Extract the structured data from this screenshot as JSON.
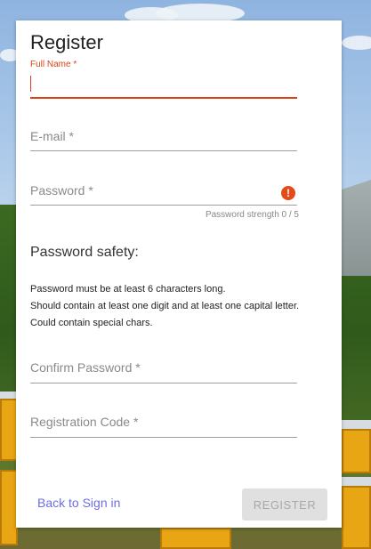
{
  "form": {
    "title": "Register",
    "fields": {
      "full_name": {
        "label": "Full Name *",
        "value": ""
      },
      "email": {
        "label": "E-mail *",
        "value": ""
      },
      "password": {
        "label": "Password *",
        "value": "",
        "strength_text": "Password strength 0 / 5",
        "warning_icon": "!"
      },
      "confirm_password": {
        "label": "Confirm Password *",
        "value": ""
      },
      "registration_code": {
        "label": "Registration Code *",
        "value": ""
      }
    },
    "password_safety": {
      "title": "Password safety:",
      "rules": [
        "Password must be at least 6 characters long.",
        "Should contain at least one digit and at least one capital letter.",
        "Could contain special chars."
      ]
    },
    "back_link": "Back to Sign in",
    "register_button": "REGISTER"
  },
  "colors": {
    "accent_error": "#d84315",
    "link": "#6e6ee0",
    "button_disabled_bg": "#e0e0e0"
  },
  "icons": {
    "password_warning": "error-icon"
  }
}
